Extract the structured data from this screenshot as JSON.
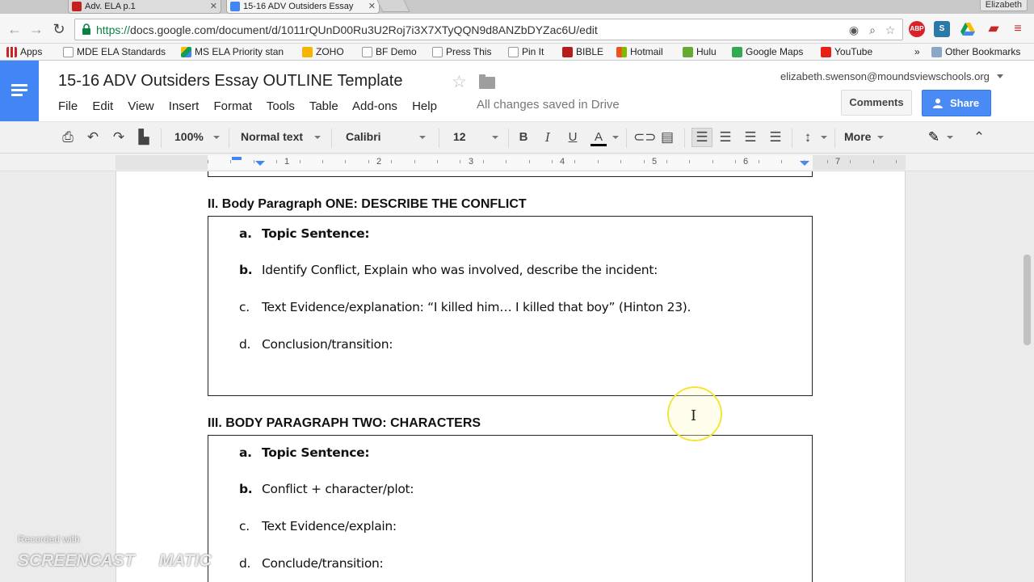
{
  "browser": {
    "tabs": [
      {
        "title": "Adv. ELA p.1",
        "favicon_color": "#d93025"
      },
      {
        "title": "15-16 ADV Outsiders Essay",
        "favicon_color": "#4285f4"
      }
    ],
    "profile": "Elizabeth",
    "url_scheme": "https://",
    "url_rest": "docs.google.com/document/d/1011rQUnD00Ru3U2Roj7i3X7XTyQQN9d8ANZbDYZac6U/edit",
    "extensions": [
      "ABP",
      "S"
    ],
    "bookmarks": [
      {
        "label": "Apps",
        "icon": "apps-grid-icon"
      },
      {
        "label": "MDE ELA Standards",
        "icon": "page-icon"
      },
      {
        "label": "MS ELA Priority stan",
        "icon": "drive-icon"
      },
      {
        "label": "ZOHO",
        "icon": "zoho-icon"
      },
      {
        "label": "BF Demo",
        "icon": "page-icon"
      },
      {
        "label": "Press This",
        "icon": "page-icon"
      },
      {
        "label": "Pin It",
        "icon": "page-icon"
      },
      {
        "label": "BIBLE",
        "icon": "bible-icon"
      },
      {
        "label": "Hotmail",
        "icon": "windows-icon"
      },
      {
        "label": "Hulu",
        "icon": "hulu-icon"
      },
      {
        "label": "Google Maps",
        "icon": "maps-icon"
      },
      {
        "label": "YouTube",
        "icon": "youtube-icon"
      }
    ],
    "more_bookmarks": "»",
    "other_bookmarks": "Other Bookmarks"
  },
  "docs": {
    "title": "15-16 ADV Outsiders Essay OUTLINE Template",
    "menu": [
      "File",
      "Edit",
      "View",
      "Insert",
      "Format",
      "Tools",
      "Table",
      "Add-ons",
      "Help"
    ],
    "saved_status": "All changes saved in Drive",
    "account_email": "elizabeth.swenson@moundsviewschools.org",
    "comments_label": "Comments",
    "share_label": "Share"
  },
  "toolbar": {
    "zoom": "100%",
    "style": "Normal text",
    "font": "Calibri",
    "size": "12",
    "more": "More"
  },
  "ruler": [
    "1",
    "2",
    "3",
    "4",
    "5",
    "6",
    "7"
  ],
  "document": {
    "section2": {
      "heading": "II. Body Paragraph ONE: DESCRIBE THE CONFLICT",
      "items": [
        {
          "marker": "a.",
          "text": "Topic Sentence:",
          "bold": true
        },
        {
          "marker": "b.",
          "text": "Identify Conflict, Explain who was involved, describe the incident:",
          "bold": false,
          "marker_bold": true
        },
        {
          "marker": "c.",
          "text": "Text Evidence/explanation: “I killed him… I killed that boy” (Hinton 23).",
          "bold": false
        },
        {
          "marker": "d.",
          "text": "Conclusion/transition:",
          "bold": false
        }
      ]
    },
    "section3": {
      "heading": "III. BODY PARAGRAPH TWO: CHARACTERS",
      "items": [
        {
          "marker": "a.",
          "text": "Topic Sentence:",
          "bold": true
        },
        {
          "marker": "b.",
          "text": "Conflict + character/plot:",
          "bold": false,
          "marker_bold": true
        },
        {
          "marker": "c.",
          "text": "Text Evidence/explain:",
          "bold": false
        },
        {
          "marker": "d.",
          "text": "Conclude/transition:",
          "bold": false
        }
      ]
    }
  },
  "watermark": {
    "line1": "Recorded with",
    "line2": "SCREENCAST",
    "line3": "MATIC"
  }
}
